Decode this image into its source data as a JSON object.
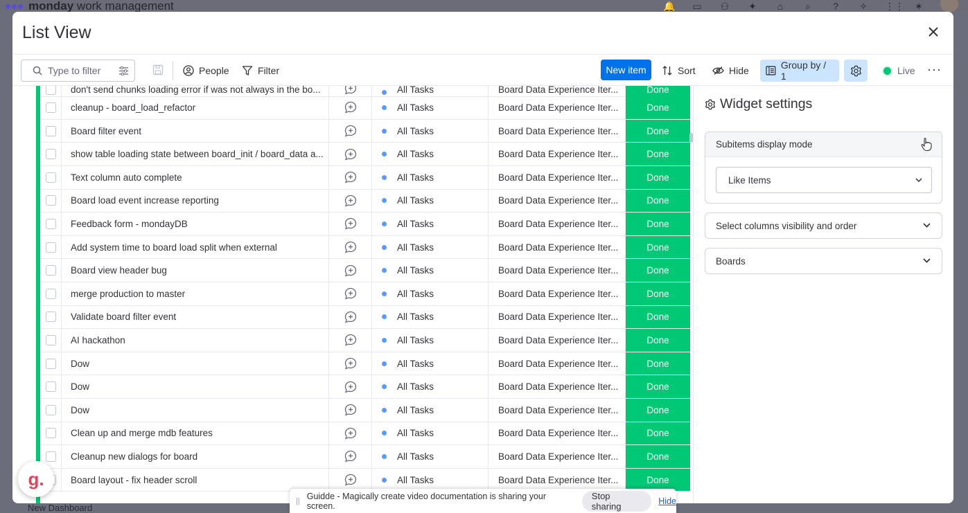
{
  "app": {
    "name_bold": "monday",
    "name_light": " work management",
    "bottom_item": "New Dashboard"
  },
  "dialog": {
    "title": "List View"
  },
  "toolbar": {
    "filter_placeholder": "Type to filter",
    "people_label": "People",
    "filter_label": "Filter",
    "new_item_label": "New item",
    "sort_label": "Sort",
    "hide_label": "Hide",
    "group_by_label": "Group by / 1",
    "live_label": "Live",
    "more_label": "···"
  },
  "table": {
    "partial_row": {
      "name": "don't send chunks loading error if was not always in the bo...",
      "group": "All Tasks",
      "board": "Board Data Experience Iter...",
      "status": "Done"
    },
    "rows": [
      {
        "name": "cleanup - board_load_refactor",
        "group": "All Tasks",
        "board": "Board Data Experience Iter...",
        "status": "Done"
      },
      {
        "name": "Board filter event",
        "group": "All Tasks",
        "board": "Board Data Experience Iter...",
        "status": "Done"
      },
      {
        "name": "show table loading state between board_init / board_data a...",
        "group": "All Tasks",
        "board": "Board Data Experience Iter...",
        "status": "Done"
      },
      {
        "name": "Text column auto complete",
        "group": "All Tasks",
        "board": "Board Data Experience Iter...",
        "status": "Done"
      },
      {
        "name": "Board load event increase reporting",
        "group": "All Tasks",
        "board": "Board Data Experience Iter...",
        "status": "Done"
      },
      {
        "name": "Feedback form - mondayDB",
        "group": "All Tasks",
        "board": "Board Data Experience Iter...",
        "status": "Done"
      },
      {
        "name": "Add system time to board load split when external",
        "group": "All Tasks",
        "board": "Board Data Experience Iter...",
        "status": "Done"
      },
      {
        "name": "Board view header bug",
        "group": "All Tasks",
        "board": "Board Data Experience Iter...",
        "status": "Done"
      },
      {
        "name": "merge production to master",
        "group": "All Tasks",
        "board": "Board Data Experience Iter...",
        "status": "Done"
      },
      {
        "name": "Validate board filter event",
        "group": "All Tasks",
        "board": "Board Data Experience Iter...",
        "status": "Done"
      },
      {
        "name": "AI hackathon",
        "group": "All Tasks",
        "board": "Board Data Experience Iter...",
        "status": "Done"
      },
      {
        "name": "Dow",
        "group": "All Tasks",
        "board": "Board Data Experience Iter...",
        "status": "Done"
      },
      {
        "name": "Dow",
        "group": "All Tasks",
        "board": "Board Data Experience Iter...",
        "status": "Done"
      },
      {
        "name": "Dow",
        "group": "All Tasks",
        "board": "Board Data Experience Iter...",
        "status": "Done"
      },
      {
        "name": "Clean up and merge mdb features",
        "group": "All Tasks",
        "board": "Board Data Experience Iter...",
        "status": "Done"
      },
      {
        "name": "Cleanup new dialogs for board",
        "group": "All Tasks",
        "board": "Board Data Experience Iter...",
        "status": "Done"
      },
      {
        "name": "Board layout - fix header scroll",
        "group": "All Tasks",
        "board": "Board Data Experience Iter...",
        "status": "Done"
      }
    ]
  },
  "widget_settings": {
    "title": "Widget settings",
    "sections": [
      {
        "label": "Subitems display mode",
        "expanded": true,
        "value": "Like Items"
      },
      {
        "label": "Select columns visibility and order",
        "expanded": false
      },
      {
        "label": "Boards",
        "expanded": false
      }
    ]
  },
  "sharing_bar": {
    "message": "Guidde - Magically create video documentation is sharing your screen.",
    "stop_label": "Stop sharing",
    "hide_label": "Hide"
  },
  "guidde_logo_letter": "g.",
  "colors": {
    "status_done": "#00c875",
    "primary": "#0073ea",
    "group_dot": "#579bfc"
  }
}
